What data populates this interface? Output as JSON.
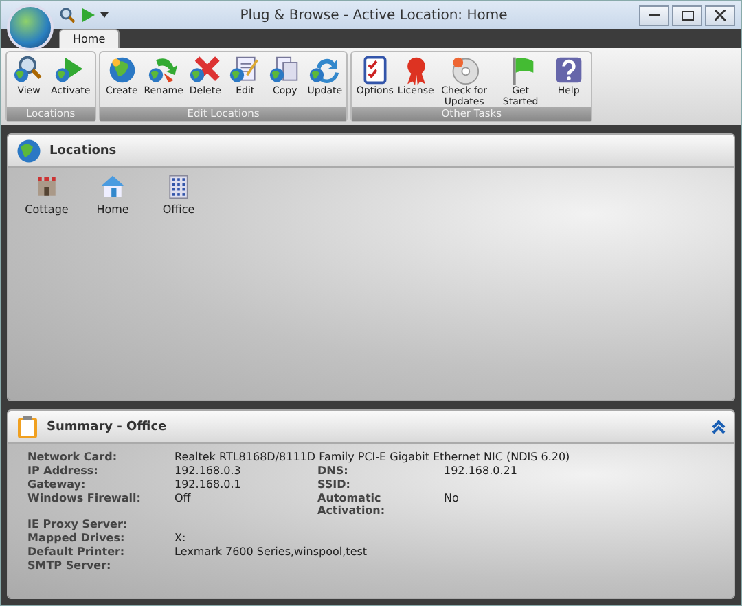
{
  "window": {
    "title": "Plug & Browse - Active Location: Home"
  },
  "tabs": [
    {
      "label": "Home",
      "selected": true
    }
  ],
  "ribbon_groups": [
    {
      "name": "Locations",
      "buttons": [
        {
          "label": "View"
        },
        {
          "label": "Activate"
        }
      ]
    },
    {
      "name": "Edit Locations",
      "buttons": [
        {
          "label": "Create"
        },
        {
          "label": "Rename"
        },
        {
          "label": "Delete"
        },
        {
          "label": "Edit"
        },
        {
          "label": "Copy"
        },
        {
          "label": "Update"
        }
      ]
    },
    {
      "name": "Other Tasks",
      "buttons": [
        {
          "label": "Options"
        },
        {
          "label": "License"
        },
        {
          "label": "Check for Updates"
        },
        {
          "label": "Get Started"
        },
        {
          "label": "Help"
        }
      ]
    }
  ],
  "locations_panel": {
    "title": "Locations",
    "items": [
      {
        "label": "Cottage"
      },
      {
        "label": "Home"
      },
      {
        "label": "Office"
      }
    ]
  },
  "summary_panel": {
    "title": "Summary - Office",
    "rows": [
      [
        {
          "label": "Network Card:",
          "value": "Realtek RTL8168D/8111D Family PCI-E Gigabit Ethernet NIC (NDIS 6.20)"
        }
      ],
      [
        {
          "label": "IP Address:",
          "value": "192.168.0.3"
        },
        {
          "label": "DNS:",
          "value": "192.168.0.21"
        }
      ],
      [
        {
          "label": "Gateway:",
          "value": "192.168.0.1"
        },
        {
          "label": "SSID:"
        }
      ],
      [
        {
          "label": "Windows Firewall:",
          "value": "Off"
        },
        {
          "label": "Automatic Activation:",
          "value": "No"
        }
      ],
      [
        {
          "label": "IE Proxy Server:"
        }
      ],
      [
        {
          "label": "Mapped Drives:",
          "value": "X:"
        }
      ],
      [
        {
          "label": "Default Printer:",
          "value": "Lexmark 7600 Series,winspool,test"
        }
      ],
      [
        {
          "label": "SMTP Server:"
        }
      ]
    ]
  }
}
